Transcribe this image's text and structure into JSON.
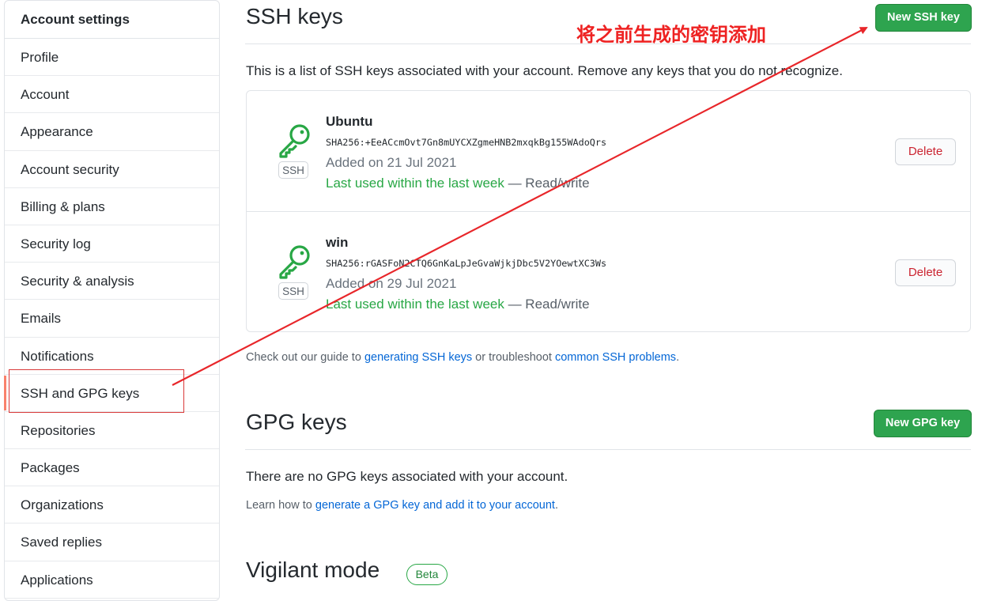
{
  "sidebar": {
    "header": "Account settings",
    "items": [
      {
        "label": "Profile"
      },
      {
        "label": "Account"
      },
      {
        "label": "Appearance"
      },
      {
        "label": "Account security"
      },
      {
        "label": "Billing & plans"
      },
      {
        "label": "Security log"
      },
      {
        "label": "Security & analysis"
      },
      {
        "label": "Emails"
      },
      {
        "label": "Notifications"
      },
      {
        "label": "SSH and GPG keys",
        "active": true
      },
      {
        "label": "Repositories"
      },
      {
        "label": "Packages"
      },
      {
        "label": "Organizations"
      },
      {
        "label": "Saved replies"
      },
      {
        "label": "Applications"
      }
    ]
  },
  "ssh": {
    "title": "SSH keys",
    "new_button": "New SSH key",
    "description": "This is a list of SSH keys associated with your account. Remove any keys that you do not recognize.",
    "keys": [
      {
        "badge": "SSH",
        "name": "Ubuntu",
        "fingerprint": "SHA256:+EeACcmOvt7Gn8mUYCXZgmeHNB2mxqkBg155WAdoQrs",
        "added": "Added on 21 Jul 2021",
        "last_used": "Last used within the last week",
        "access": " — Read/write",
        "delete": "Delete"
      },
      {
        "badge": "SSH",
        "name": "win",
        "fingerprint": "SHA256:rGASFoN2CTQ6GnKaLpJeGvaWjkjDbc5V2YOewtXC3Ws",
        "added": "Added on 29 Jul 2021",
        "last_used": "Last used within the last week",
        "access": " — Read/write",
        "delete": "Delete"
      }
    ],
    "guide_prefix": "Check out our guide to ",
    "guide_link1": "generating SSH keys",
    "guide_middle": " or troubleshoot ",
    "guide_link2": "common SSH problems",
    "guide_suffix": "."
  },
  "gpg": {
    "title": "GPG keys",
    "new_button": "New GPG key",
    "empty_text": "There are no GPG keys associated with your account.",
    "learn_prefix": "Learn how to ",
    "learn_link": "generate a GPG key and add it to your account",
    "learn_suffix": "."
  },
  "vigilant": {
    "title": "Vigilant mode",
    "badge": "Beta"
  },
  "annotation": {
    "text": "将之前生成的密钥添加",
    "color": "#ee2222"
  },
  "colors": {
    "green": "#2ea44f",
    "link": "#0366d6",
    "danger": "#cb2431",
    "active_marker": "#f9826c"
  }
}
